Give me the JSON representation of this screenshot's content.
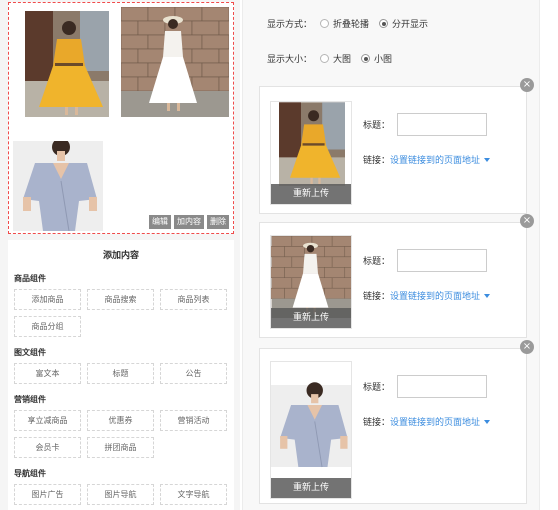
{
  "preview": {
    "actions": [
      "编辑",
      "加内容",
      "删除"
    ]
  },
  "add_content": {
    "title": "添加内容",
    "groups": [
      {
        "title": "商品组件",
        "items": [
          "添加商品",
          "商品搜索",
          "商品列表",
          "商品分组"
        ]
      },
      {
        "title": "图文组件",
        "items": [
          "富文本",
          "标题",
          "公告"
        ]
      },
      {
        "title": "营销组件",
        "items": [
          "享立减商品",
          "优惠券",
          "营销活动",
          "会员卡",
          "拼团商品"
        ]
      },
      {
        "title": "导航组件",
        "items": [
          "图片广告",
          "图片导航",
          "文字导航"
        ]
      }
    ]
  },
  "settings": {
    "display_mode": {
      "label": "显示方式：",
      "options": [
        "折叠轮播",
        "分开显示"
      ],
      "selected": "分开显示"
    },
    "display_size": {
      "label": "显示大小：",
      "options": [
        "大图",
        "小图"
      ],
      "selected": "小图"
    }
  },
  "cards": [
    {
      "reupload": "重新上传",
      "title_label": "标题：",
      "title_value": "",
      "link_label": "链接：",
      "link_text": "设置链接到的页面地址"
    },
    {
      "reupload": "重新上传",
      "title_label": "标题：",
      "title_value": "",
      "link_label": "链接：",
      "link_text": "设置链接到的页面地址"
    },
    {
      "reupload": "重新上传",
      "title_label": "标题：",
      "title_value": "",
      "link_label": "链接：",
      "link_text": "设置链接到的页面地址"
    }
  ],
  "colors": {
    "accent_link": "#3b8cdf",
    "dashed_border": "#f04b4b",
    "overlay": "#5a5a5a"
  },
  "icons": {
    "close": "close-icon",
    "dropdown": "caret-down-icon"
  }
}
